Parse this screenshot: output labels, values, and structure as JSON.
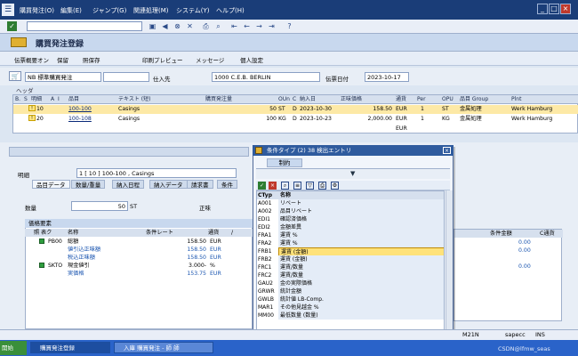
{
  "menu": {
    "items": [
      "購買発注(O)",
      "編集(E)",
      "ジャンプ(G)",
      "関連処理(M)",
      "システム(Y)",
      "ヘルプ(H)"
    ]
  },
  "window": {
    "title": "購買発注登録"
  },
  "toolbar": {
    "items": [
      "伝票概要オン",
      "保留",
      "照保存",
      "印刷プレビュー",
      "メッセージ",
      "個人設定"
    ]
  },
  "header": {
    "doc_type": "NB 標準購買発注",
    "vendor_label": "仕入先",
    "vendor_value": "1000 C.E.B. BERLIN",
    "doc_date_label": "伝票日付",
    "doc_date_value": "2023-10-17"
  },
  "header_label": "ヘッダ",
  "items_grid": {
    "columns": [
      "B.",
      "S",
      "明細",
      "A",
      "I",
      "品目",
      "テキスト (短)",
      "購買発注量",
      "OUn",
      "C",
      "納入日",
      "正味価格",
      "通貨",
      "Per",
      "OPU",
      "品目 Group",
      "Plnt"
    ],
    "rows": [
      {
        "item": "10",
        "material": "100-100",
        "text": "Casings",
        "qty": "50",
        "unit": "ST",
        "c": "D",
        "date": "2023-10-30",
        "price": "158.50",
        "curr": "EUR",
        "per": "1",
        "opu": "ST",
        "group": "金属処理",
        "plant": "Werk Hamburg"
      },
      {
        "item": "20",
        "material": "100-108",
        "text": "Casings",
        "qty": "100",
        "unit": "KG",
        "c": "D",
        "date": "2023-10-23",
        "price": "2,000.00",
        "curr": "EUR",
        "per": "1",
        "opu": "KG",
        "group": "金属処理",
        "plant": "Werk Hamburg"
      },
      {
        "curr": "EUR"
      }
    ]
  },
  "item_detail": {
    "label": "明細",
    "selector": "1 [ 10 ] 100-100 , Casings",
    "tabs": [
      "品目データ",
      "数量/重量",
      "納入日程",
      "納入データ",
      "請求書",
      "条件"
    ],
    "qty_label": "数量",
    "qty_value": "50",
    "qty_unit": "ST",
    "net_label": "正味"
  },
  "conditions": {
    "title": "価格要素",
    "columns": [
      "照",
      "表ク",
      "名称",
      "条件レート",
      "通貨",
      "/",
      "条件金額",
      "C通貨"
    ],
    "rows": [
      {
        "code": "PB00",
        "name": "総額",
        "rate": "158.50",
        "curr": "EUR"
      },
      {
        "code": "",
        "name": "値引込正味額",
        "rate": "158.50",
        "curr": "EUR"
      },
      {
        "code": "",
        "name": "税込正味額",
        "rate": "158.50",
        "curr": "EUR"
      },
      {
        "code": "SKTO",
        "name": "現金値引",
        "rate": "3.000-",
        "curr": "%"
      },
      {
        "code": "",
        "name": "実価格",
        "rate": "153.75",
        "curr": "EUR"
      }
    ],
    "right_amounts": [
      "0.00",
      "0.00",
      "0.00"
    ]
  },
  "popup": {
    "title": "条件タイプ (2)   38 検出エントリ",
    "tab": "制約",
    "header_code": "CTyp",
    "header_name": "名称",
    "entries": [
      {
        "code": "A001",
        "name": "リベート"
      },
      {
        "code": "A002",
        "name": "品目リベート"
      },
      {
        "code": "EDI1",
        "name": "確認済価格"
      },
      {
        "code": "EDI2",
        "name": "金額差異"
      },
      {
        "code": "FRA1",
        "name": "運賃 %"
      },
      {
        "code": "FRA2",
        "name": "運賃 %"
      },
      {
        "code": "FRB1",
        "name": "運賃 (金額)"
      },
      {
        "code": "FRB2",
        "name": "運賃 (金額)"
      },
      {
        "code": "FRC1",
        "name": "運賃/数量"
      },
      {
        "code": "FRC2",
        "name": "運賃/数量"
      },
      {
        "code": "GAU2",
        "name": "金の実際価格"
      },
      {
        "code": "GRWR",
        "name": "統計金額"
      },
      {
        "code": "GWLB",
        "name": "統計値 LB-Comp."
      },
      {
        "code": "MAR1",
        "name": "その他見越金 %"
      },
      {
        "code": "MM00",
        "name": "最低数量 (数量)"
      }
    ],
    "highlight_index": 6
  },
  "statusbar": {
    "session": "M21N",
    "server": "sapecc",
    "mode": "INS"
  },
  "taskbar": {
    "start": "開始",
    "tasks": [
      "購買発注登録",
      "入庫 購買発注 - 師 師"
    ],
    "watermark": "CSDN@lfmw_seas"
  }
}
